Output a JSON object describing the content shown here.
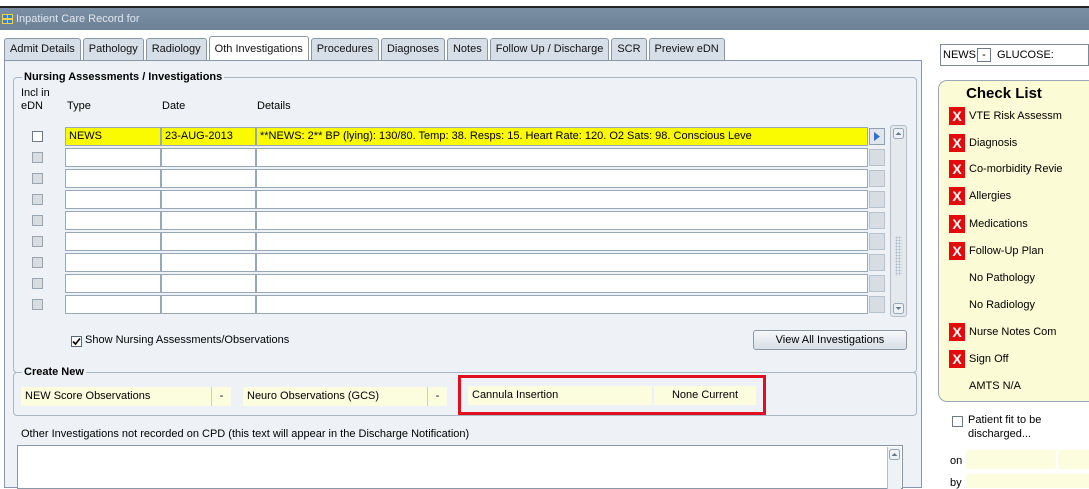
{
  "window": {
    "title": "Inpatient Care Record for"
  },
  "tabs": [
    {
      "label": "Admit Details"
    },
    {
      "label": "Pathology"
    },
    {
      "label": "Radiology"
    },
    {
      "label": "Oth Investigations",
      "active": true
    },
    {
      "label": "Procedures"
    },
    {
      "label": "Diagnoses"
    },
    {
      "label": "Notes"
    },
    {
      "label": "Follow Up / Discharge"
    },
    {
      "label": "SCR"
    },
    {
      "label": "Preview eDN"
    }
  ],
  "nursing": {
    "title": "Nursing Assessments / Investigations",
    "col_incl_1": "Incl in",
    "col_incl_2": "eDN",
    "col_type": "Type",
    "col_date": "Date",
    "col_details": "Details",
    "rows": [
      {
        "type": "NEWS",
        "date": "23-AUG-2013",
        "details": "**NEWS: 2** BP (lying): 130/80. Temp: 38. Resps: 15. Heart Rate: 120. O2 Sats: 98. Conscious Leve"
      },
      {
        "type": "",
        "date": "",
        "details": ""
      },
      {
        "type": "",
        "date": "",
        "details": ""
      },
      {
        "type": "",
        "date": "",
        "details": ""
      },
      {
        "type": "",
        "date": "",
        "details": ""
      },
      {
        "type": "",
        "date": "",
        "details": ""
      },
      {
        "type": "",
        "date": "",
        "details": ""
      },
      {
        "type": "",
        "date": "",
        "details": ""
      },
      {
        "type": "",
        "date": "",
        "details": ""
      }
    ],
    "show_checkbox_label": "Show Nursing Assessments/Observations",
    "view_all_label": "View All Investigations"
  },
  "create_new": {
    "title": "Create New",
    "new_score": "NEW Score Observations",
    "neuro": "Neuro Observations (GCS)",
    "cannula": "Cannula Insertion",
    "cannula_status": "None Current",
    "dash": "-"
  },
  "other_investigations": {
    "label": "Other Investigations not recorded on CPD (this text will appear in the Discharge Notification)",
    "value": ""
  },
  "right_panel": {
    "news_label": "NEWS:",
    "news_value": "-",
    "glucose_label": "GLUCOSE:",
    "checklist_title": "Check List",
    "items": [
      {
        "label": "VTE Risk Assessm",
        "flag": true
      },
      {
        "label": "Diagnosis",
        "flag": true
      },
      {
        "label": "Co-morbidity Revie",
        "flag": true
      },
      {
        "label": "Allergies",
        "flag": true
      },
      {
        "label": "Medications",
        "flag": true
      },
      {
        "label": "Follow-Up Plan",
        "flag": true
      },
      {
        "label": "No Pathology",
        "flag": false
      },
      {
        "label": "No Radiology",
        "flag": false
      },
      {
        "label": "Nurse Notes Com",
        "flag": true
      },
      {
        "label": "Sign Off",
        "flag": true
      },
      {
        "label": "AMTS N/A",
        "flag": false
      }
    ],
    "x_glyph": "X",
    "fit_label_1": "Patient fit to be",
    "fit_label_2": "discharged...",
    "on_label": "on",
    "by_label": "by"
  },
  "colors": {
    "highlight_yellow": "#fbfb00",
    "field_bg": "#fcfcde",
    "checklist_bg": "#fbfbd6",
    "flag_red": "#e4090b",
    "annotation_red": "#e01020",
    "titlebar": "#6d8196"
  }
}
